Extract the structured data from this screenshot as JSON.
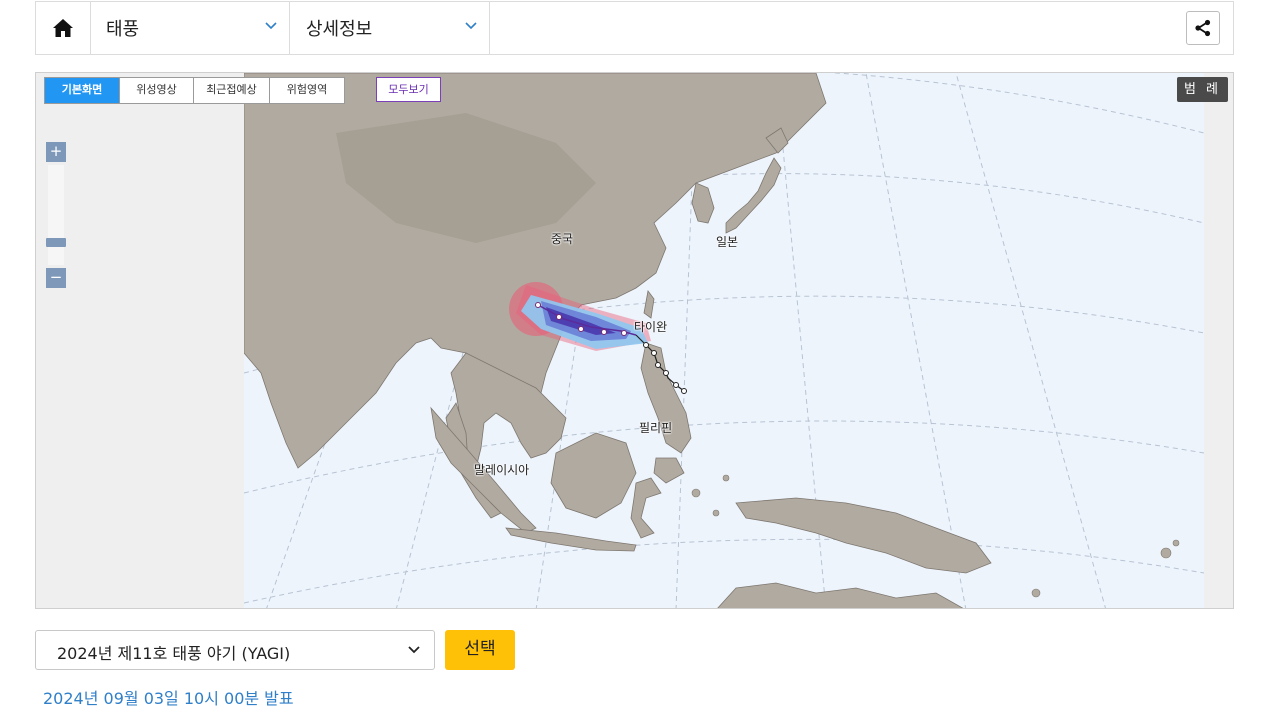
{
  "nav": {
    "menu1": "태풍",
    "menu2": "상세정보"
  },
  "map": {
    "tabs": [
      "기본화면",
      "위성영상",
      "최근접예상",
      "위험영역"
    ],
    "view_all": "모두보기",
    "legend": "범 례",
    "zoom_in": "+",
    "zoom_out": "−",
    "places": {
      "china": "중국",
      "japan": "일본",
      "taiwan": "타이완",
      "philippines": "필리핀",
      "malaysia": "말레이시아"
    }
  },
  "typhoon_select": {
    "value": "2024년 제11호 태풍 야기 (YAGI)"
  },
  "select_button": "선택",
  "announcement": "2024년 09월 03일 10시 00분 발표",
  "colors": {
    "accent_blue": "#2196f3",
    "select_yellow": "#ffc107",
    "announcement_blue": "#2f7fc9",
    "risk_red": "#e8607a",
    "track_blue": "#4aa3e8",
    "track_purple": "#6a4bc2"
  }
}
